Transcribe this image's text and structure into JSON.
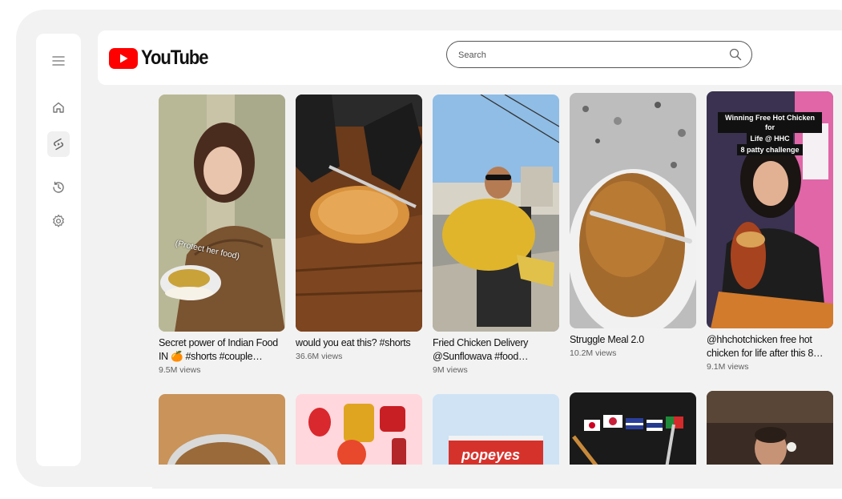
{
  "app": {
    "name": "YouTube"
  },
  "search": {
    "placeholder": "Search"
  },
  "sidebar": {
    "items": [
      {
        "icon": "menu-icon"
      },
      {
        "icon": "home-icon"
      },
      {
        "icon": "shorts-icon",
        "active": true
      },
      {
        "icon": "history-icon"
      },
      {
        "icon": "settings-icon"
      }
    ]
  },
  "shorts": [
    {
      "title_line1": "Secret power of Indian Food",
      "title_line2": "IN 🍊 #shorts #couple…",
      "views": "9.5M views",
      "overlay": "(Protect her food)"
    },
    {
      "title_line1": "would you eat this? #shorts",
      "title_line2": "",
      "views": "36.6M views"
    },
    {
      "title_line1": "Fried Chicken Delivery",
      "title_line2": "@Sunflowava #food…",
      "views": "9M views"
    },
    {
      "title_line1": "Struggle Meal 2.0",
      "title_line2": "",
      "views": "10.2M views"
    },
    {
      "title_line1": "@hhchotchicken free hot",
      "title_line2": "chicken for life after this 8…",
      "views": "9.1M views",
      "overlay_line1": "Winning Free Hot Chicken for",
      "overlay_line2": "Life @ HHC",
      "overlay_line3": "8 patty challenge"
    }
  ],
  "second_row": [
    {
      "thumb_text": ""
    },
    {
      "thumb_text": ""
    },
    {
      "thumb_text": "popeyes"
    },
    {
      "thumb_text": ""
    },
    {
      "thumb_text": ""
    }
  ],
  "colors": {
    "brand_red": "#ff0000",
    "background": "#f2f2f2"
  }
}
